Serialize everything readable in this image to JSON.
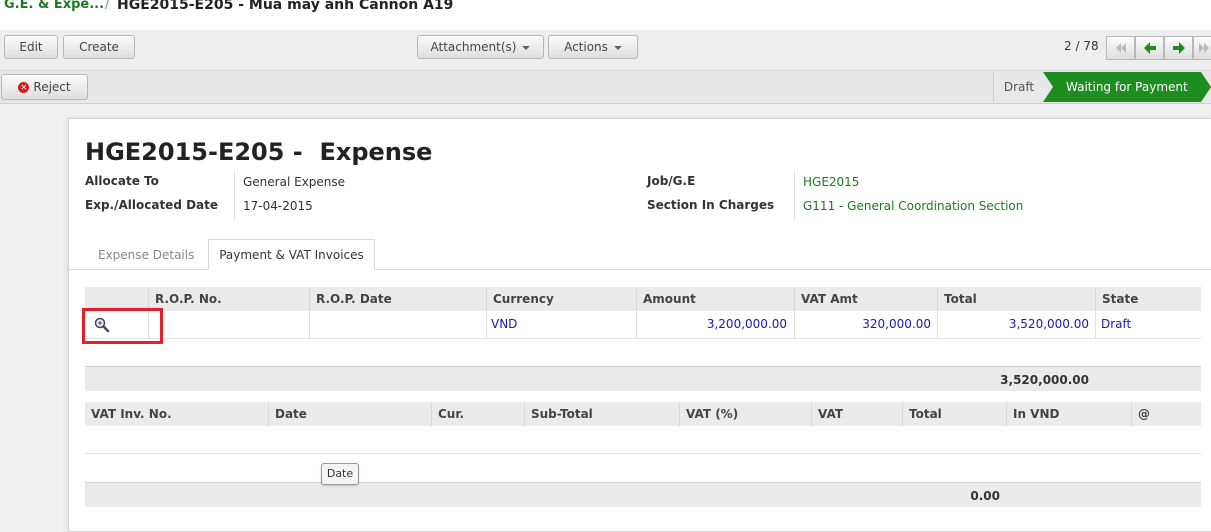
{
  "breadcrumb": {
    "parent": "G.E. & Expe...",
    "separator": "/",
    "title": "HGE2015-E205 - Mua máy ảnh Cannon A19"
  },
  "toolbar": {
    "edit_label": "Edit",
    "create_label": "Create",
    "attachments_label": "Attachment(s)",
    "actions_label": "Actions",
    "pager": "2 / 78"
  },
  "statusbar": {
    "reject_label": "Reject",
    "stages": [
      "Draft",
      "Waiting for Payment"
    ]
  },
  "form": {
    "doc_id": "HGE2015-E205",
    "doc_type": "Expense",
    "fields_left": [
      {
        "label": "Allocate To",
        "value": "General Expense"
      },
      {
        "label": "Exp./Allocated Date",
        "value": "17-04-2015"
      }
    ],
    "fields_right": [
      {
        "label": "Job/G.E",
        "value": "HGE2015"
      },
      {
        "label": "Section In Charges",
        "value": "G111 - General Coordination Section"
      }
    ]
  },
  "tabs": [
    "Expense Details",
    "Payment & VAT Invoices"
  ],
  "payment_table": {
    "columns": [
      "",
      "R.O.P. No.",
      "R.O.P. Date",
      "Currency",
      "Amount",
      "VAT Amt",
      "Total",
      "State"
    ],
    "rows": [
      {
        "rop_no": "",
        "rop_date": "",
        "currency": "VND",
        "amount": "3,200,000.00",
        "vat_amt": "320,000.00",
        "total": "3,520,000.00",
        "state": "Draft"
      }
    ],
    "footer_total": "3,520,000.00"
  },
  "vat_table": {
    "columns": [
      "VAT Inv. No.",
      "Date",
      "Cur.",
      "Sub-Total",
      "VAT (%)",
      "VAT",
      "Total",
      "In VND",
      "@"
    ],
    "footer_total": "0.00"
  },
  "tooltip": "Date",
  "colors": {
    "brand_green": "#1f7a1f",
    "stage_active": "#1e8c1e",
    "highlight_red": "#e2202a",
    "link_blue": "#1a1aaa"
  }
}
